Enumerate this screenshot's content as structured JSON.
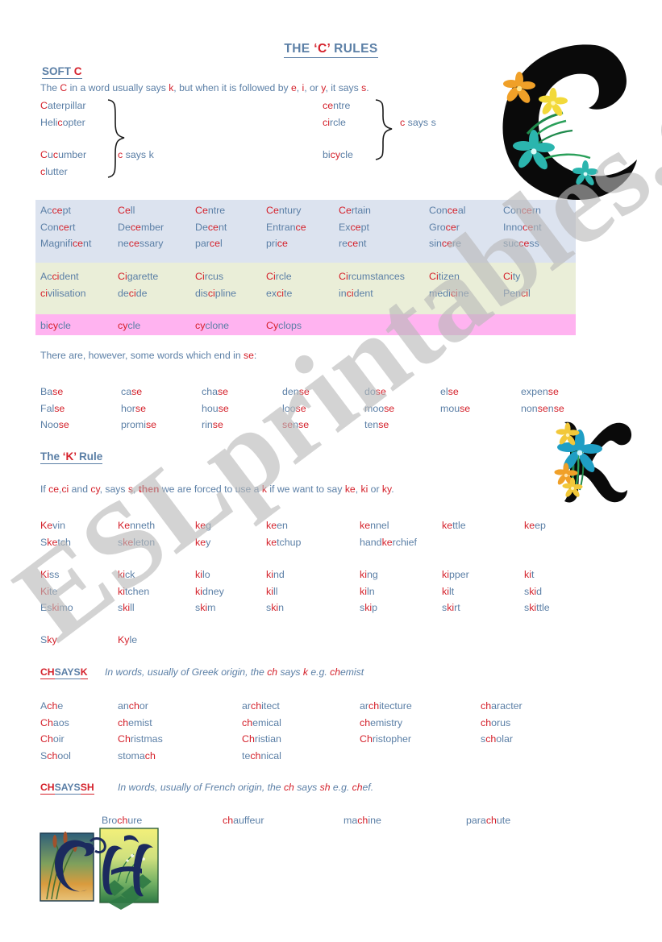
{
  "title": {
    "pre": "THE ",
    "letter": "‘C’",
    "post": " RULES"
  },
  "soft_c": {
    "heading_pre": "SOFT ",
    "heading_letter": "C",
    "rule_a": "The ",
    "rule_c": "C",
    "rule_b": " in a word usually says ",
    "rule_k": "k",
    "rule_d": ", but when it is followed by ",
    "rule_e": "e",
    "rule_f": ", ",
    "rule_i": "i",
    "rule_g": ", or ",
    "rule_y": "y",
    "rule_h": ", it says ",
    "rule_s": "s",
    "rule_end": ".",
    "left_words": [
      "Caterpillar",
      "Helicopter",
      "Cucumber",
      "clutter"
    ],
    "right_words": [
      "centre",
      "circle",
      "bicycle"
    ],
    "label_k": "c says k",
    "label_s": "c says s"
  },
  "table": {
    "rows_ce": [
      [
        "Accept",
        "Cell",
        "Centre",
        "Century",
        "Certain",
        "Conceal",
        "Concern"
      ],
      [
        "Concert",
        "December",
        "Decent",
        "Entrance",
        "Except",
        "Grocer",
        "Innocent"
      ],
      [
        "Magnificent",
        "necessary",
        "parcel",
        "price",
        "recent",
        "sincere",
        "success"
      ]
    ],
    "rows_ci": [
      [
        "Accident",
        "Cigarette",
        "Circus",
        "Circle",
        "Circumstances",
        "Citizen",
        "City"
      ],
      [
        "civilisation",
        "decide",
        "discipline",
        "excite",
        "incident",
        "medicine",
        "Pencil"
      ]
    ],
    "rows_cy": [
      [
        "bicycle",
        "cycle",
        "cyclone",
        "Cyclops"
      ]
    ]
  },
  "se_section": {
    "intro_a": "There are, however, some words which end in ",
    "intro_se": "se",
    "intro_b": ":",
    "rows": [
      [
        "Base",
        "case",
        "chase",
        "dense",
        "dose",
        "else",
        "expense"
      ],
      [
        "False",
        "horse",
        "house",
        "loose",
        "moose",
        "mouse",
        "nonsense"
      ],
      [
        "Noose",
        "promise",
        "rinse",
        "sense",
        "tense",
        "",
        ""
      ]
    ]
  },
  "k_rule": {
    "heading_pre": "The ",
    "heading_letter": "‘K’",
    "heading_post": " Rule",
    "text_a": "If ",
    "text_ce": "ce",
    "text_b": ",",
    "text_ci": "ci",
    "text_c": " and ",
    "text_cy": "cy",
    "text_d": ", says ",
    "text_s": "s",
    "text_e": ", ",
    "text_then": "then",
    "text_f": " we are forced to use a ",
    "text_k": "k",
    "text_g": " if we want to say ",
    "text_ke": "ke",
    "text_h": ", ",
    "text_ki": "ki",
    "text_i": " or ",
    "text_ky": "ky",
    "text_end": ".",
    "rows_ke": [
      [
        "Kevin",
        "Kenneth",
        "keg",
        "keen",
        "kennel",
        "kettle",
        "keep"
      ],
      [
        "Sketch",
        "skeleton",
        "key",
        "ketchup",
        "handkerchief",
        "",
        ""
      ]
    ],
    "rows_ki": [
      [
        "Kiss",
        "kick",
        "kilo",
        "kind",
        "king",
        "kipper",
        "kit"
      ],
      [
        "Kite",
        "kitchen",
        "kidney",
        "kill",
        "kiln",
        "kilt",
        "skid"
      ],
      [
        "Eskimo",
        "skill",
        "skim",
        "skin",
        "skip",
        "skirt",
        "skittle"
      ]
    ],
    "rows_ky": [
      [
        "Sky",
        "Kyle",
        "",
        "",
        "",
        "",
        ""
      ]
    ]
  },
  "ch_k": {
    "head_ch": "CH",
    "head_says": "SAYS",
    "head_k": "K",
    "note_a": "In words, usually of Greek origin, the ",
    "note_ch": "ch",
    "note_b": " says ",
    "note_k": "k",
    "note_c": " e.g. ",
    "note_eg": "chemist",
    "rows": [
      [
        "Ache",
        "anchor",
        "architect",
        "architecture",
        "character"
      ],
      [
        "Chaos",
        "chemist",
        "chemical",
        "chemistry",
        "chorus"
      ],
      [
        "Choir",
        "Christmas",
        "Christian",
        "Christopher",
        "scholar"
      ],
      [
        "School",
        "stomach",
        "technical",
        "",
        ""
      ]
    ]
  },
  "ch_sh": {
    "head_ch": "CH",
    "head_says": "SAYS",
    "head_sh": "SH",
    "note_a": "In words, usually of French origin, the ",
    "note_ch": "ch",
    "note_b": " says ",
    "note_sh": "sh",
    "note_c": " e.g. ",
    "note_eg": "chef",
    "note_end": ".",
    "rows": [
      [
        "Brochure",
        "chauffeur",
        "machine",
        "parachute"
      ]
    ]
  },
  "watermark": {
    "text": "ESLprintables.com"
  },
  "colors": {
    "blue": "#5b7fa6",
    "red": "#d4202a",
    "band_ce": "#dce3ef",
    "band_ci": "#eaeed8",
    "band_cy": "#ffb3f0"
  }
}
